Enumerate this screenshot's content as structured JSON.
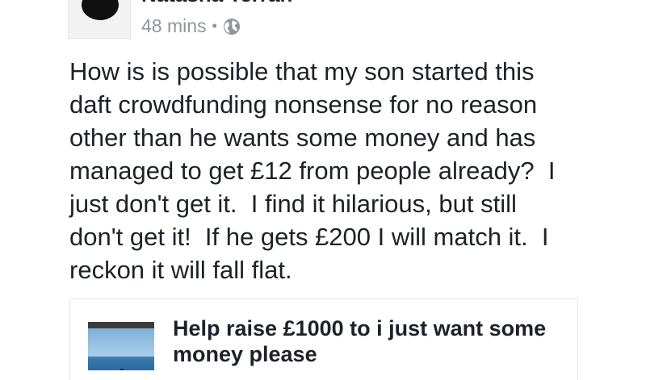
{
  "post": {
    "author": "Natasha Terrah",
    "time": "48 mins",
    "separator": "•",
    "privacy_icon": "globe-icon",
    "text_lines": [
      "How is is possible that my son started this",
      "daft crowdfunding nonsense for no reason",
      "other than he wants some money and has",
      "managed to get £12 from people already?  I",
      "just don't get it.  I find it hilarious, but still",
      "don't get it!  If he gets £200 I will match it.  I",
      "reckon it will fall flat."
    ]
  },
  "link_card": {
    "title_lines": [
      "Help raise £1000 to i just want some",
      "money please"
    ]
  }
}
